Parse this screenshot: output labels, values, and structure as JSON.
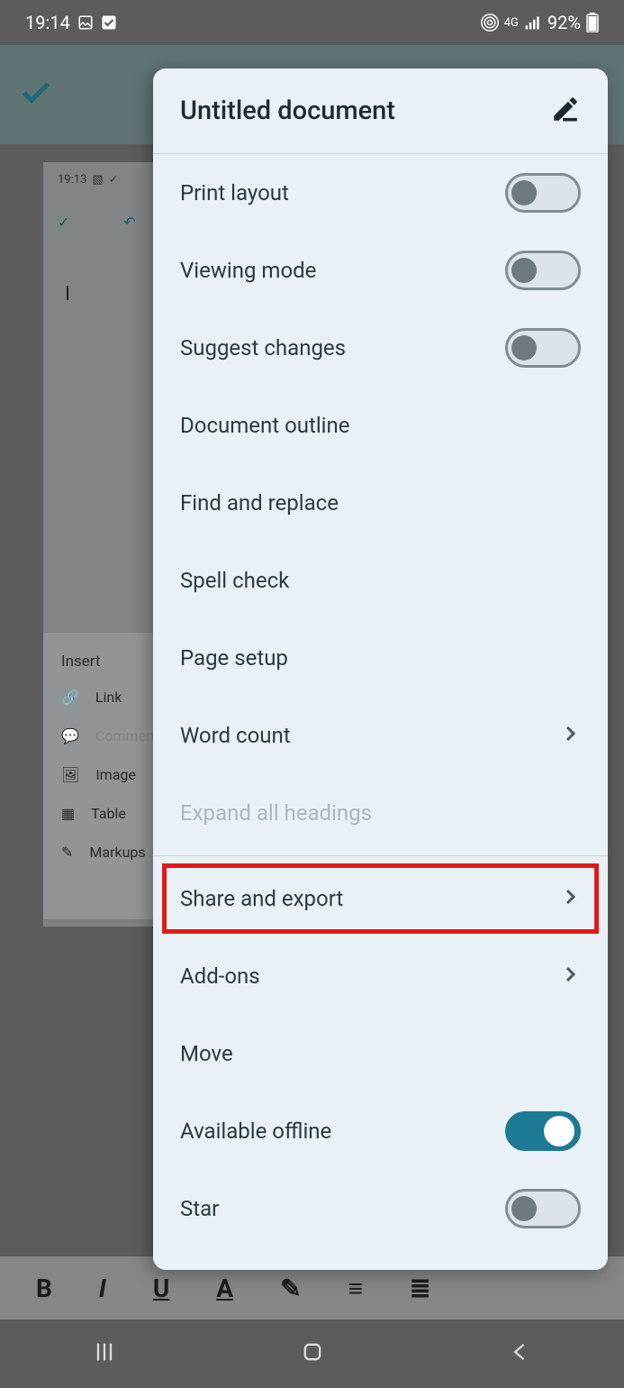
{
  "status": {
    "time": "19:14",
    "network_label": "4G",
    "battery_pct": "92%"
  },
  "bg": {
    "mini_time": "19:13",
    "insert_title": "Insert",
    "insert_items": [
      {
        "label": "Link"
      },
      {
        "label": "Comment"
      },
      {
        "label": "Image"
      },
      {
        "label": "Table"
      },
      {
        "label": "Markups"
      }
    ]
  },
  "menu": {
    "title": "Untitled document",
    "items": [
      {
        "label": "Print layout",
        "kind": "toggle",
        "on": false
      },
      {
        "label": "Viewing mode",
        "kind": "toggle",
        "on": false
      },
      {
        "label": "Suggest changes",
        "kind": "toggle",
        "on": false
      },
      {
        "label": "Document outline",
        "kind": "plain"
      },
      {
        "label": "Find and replace",
        "kind": "plain"
      },
      {
        "label": "Spell check",
        "kind": "plain"
      },
      {
        "label": "Page setup",
        "kind": "plain"
      },
      {
        "label": "Word count",
        "kind": "chevron"
      },
      {
        "label": "Expand all headings",
        "kind": "disabled"
      },
      {
        "separator": true
      },
      {
        "label": "Share and export",
        "kind": "chevron",
        "highlight": true
      },
      {
        "label": "Add-ons",
        "kind": "chevron"
      },
      {
        "label": "Move",
        "kind": "plain"
      },
      {
        "label": "Available offline",
        "kind": "toggle",
        "on": true
      },
      {
        "label": "Star",
        "kind": "toggle",
        "on": false
      }
    ]
  }
}
